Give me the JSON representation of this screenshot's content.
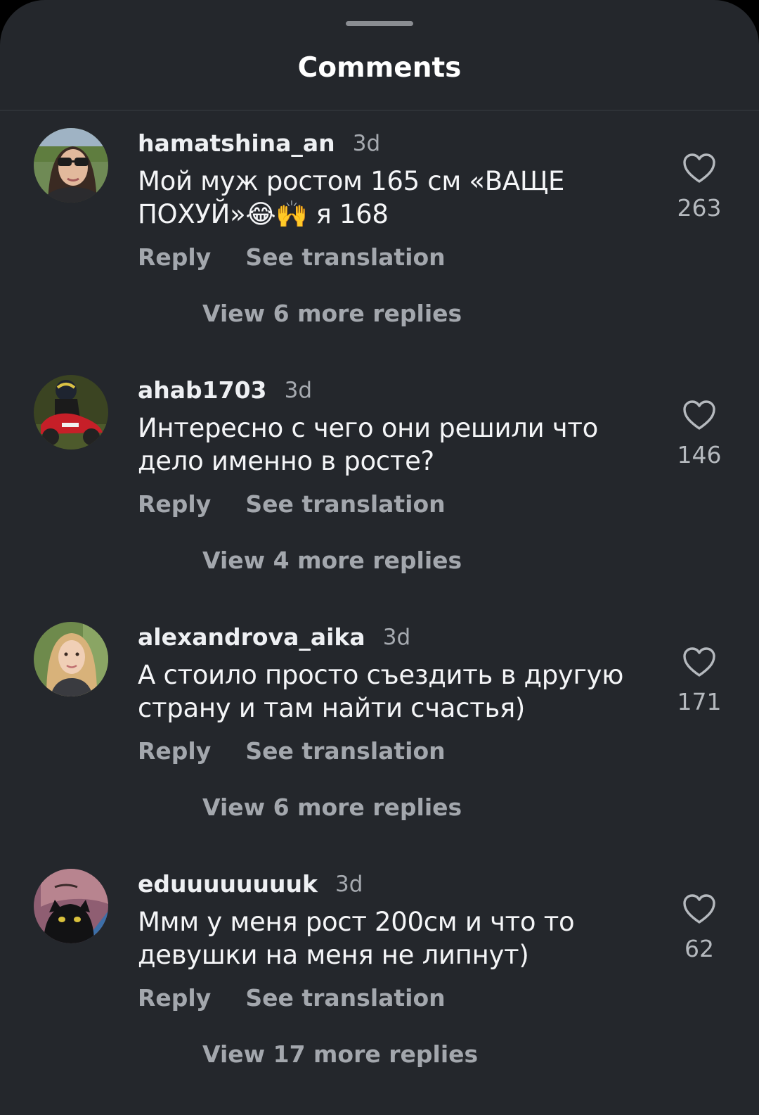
{
  "sheet": {
    "title": "Comments"
  },
  "comments": [
    {
      "username": "hamatshina_an",
      "time": "3d",
      "text": "Мой муж ростом 165 см «ВАЩЕ ПОХУЙ»😂🙌 я 168",
      "reply_label": "Reply",
      "translate_label": "See translation",
      "view_replies_label": "View 6 more replies",
      "likes": "263"
    },
    {
      "username": "ahab1703",
      "time": "3d",
      "text": "Интересно с чего они решили что дело именно в росте?",
      "reply_label": "Reply",
      "translate_label": "See translation",
      "view_replies_label": "View 4 more replies",
      "likes": "146"
    },
    {
      "username": "alexandrova_aika",
      "time": "3d",
      "text": "А стоило просто съездить в другую страну и там найти счастья)",
      "reply_label": "Reply",
      "translate_label": "See translation",
      "view_replies_label": "View 6 more replies",
      "likes": "171"
    },
    {
      "username": "eduuuuuuuuk",
      "time": "3d",
      "text": "Ммм у меня рост 200см и что то девушки на меня не липнут)",
      "reply_label": "Reply",
      "translate_label": "See translation",
      "view_replies_label": "View 17 more replies",
      "likes": "62"
    }
  ],
  "icons": {
    "like": "heart-outline-icon",
    "drag": "drag-handle"
  },
  "colors": {
    "sheet_background": "#24272c",
    "primary_text": "#f4f5f7",
    "secondary_text": "#a3a7ad"
  }
}
